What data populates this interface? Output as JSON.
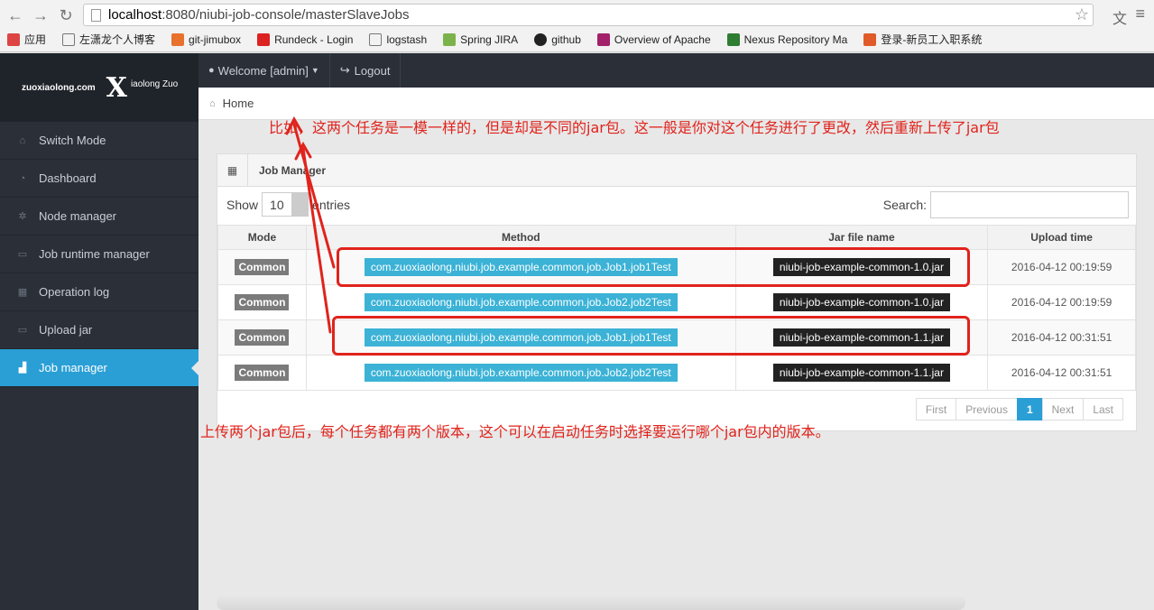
{
  "browser": {
    "url_host": "localhost",
    "url_rest": ":8080/niubi-job-console/masterSlaveJobs",
    "bookmarks": [
      "应用",
      "左潇龙个人博客",
      "git-jimubox",
      "Rundeck - Login",
      "logstash",
      "Spring JIRA",
      "github",
      "Overview of Apache",
      "Nexus Repository Ma",
      "登录-新员工入职系统"
    ]
  },
  "logo": {
    "site": "zuoxiaolong.com",
    "brand": "iaolong Zuo"
  },
  "sidebar": {
    "items": [
      {
        "label": "Switch Mode",
        "icon": "home-icon"
      },
      {
        "label": "Dashboard",
        "icon": "dashboard-icon"
      },
      {
        "label": "Node manager",
        "icon": "gear-icon"
      },
      {
        "label": "Job runtime manager",
        "icon": "drive-icon"
      },
      {
        "label": "Operation log",
        "icon": "grid-icon"
      },
      {
        "label": "Upload jar",
        "icon": "drive-icon"
      },
      {
        "label": "Job manager",
        "icon": "chart-icon",
        "active": true
      }
    ]
  },
  "topbar": {
    "welcome": "Welcome [admin]",
    "logout": "Logout"
  },
  "breadcrumb": {
    "home": "Home"
  },
  "panel": {
    "title": "Job Manager",
    "show_label": "Show",
    "page_length": "10",
    "entries_label": "entries",
    "search_label": "Search:",
    "columns": [
      "Mode",
      "Method",
      "Jar file name",
      "Upload time"
    ],
    "rows": [
      {
        "mode": "Common",
        "method": "com.zuoxiaolong.niubi.job.example.common.job.Job1.job1Test",
        "jar": "niubi-job-example-common-1.0.jar",
        "time": "2016-04-12 00:19:59"
      },
      {
        "mode": "Common",
        "method": "com.zuoxiaolong.niubi.job.example.common.job.Job2.job2Test",
        "jar": "niubi-job-example-common-1.0.jar",
        "time": "2016-04-12 00:19:59"
      },
      {
        "mode": "Common",
        "method": "com.zuoxiaolong.niubi.job.example.common.job.Job1.job1Test",
        "jar": "niubi-job-example-common-1.1.jar",
        "time": "2016-04-12 00:31:51"
      },
      {
        "mode": "Common",
        "method": "com.zuoxiaolong.niubi.job.example.common.job.Job2.job2Test",
        "jar": "niubi-job-example-common-1.1.jar",
        "time": "2016-04-12 00:31:51"
      }
    ],
    "pager": {
      "first": "First",
      "previous": "Previous",
      "current": "1",
      "next": "Next",
      "last": "Last"
    }
  },
  "annotations": {
    "top": "比如，这两个任务是一模一样的，但是却是不同的jar包。这一般是你对这个任务进行了更改，然后重新上传了jar包",
    "bottom": "上传两个jar包后，每个任务都有两个版本，这个可以在启动任务时选择要运行哪个jar包内的版本。",
    "color": "#e0231c"
  }
}
